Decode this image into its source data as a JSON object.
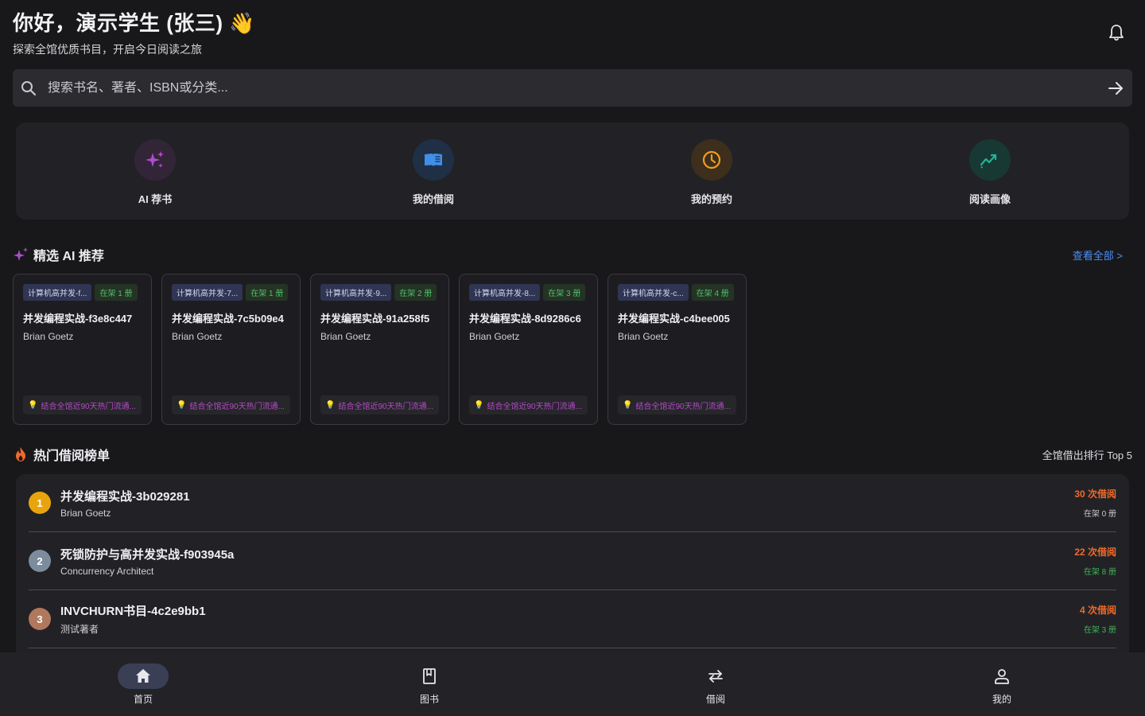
{
  "header": {
    "greeting": "你好，演示学生 (张三) 👋",
    "subtitle": "探索全馆优质书目，开启今日阅读之旅"
  },
  "search": {
    "placeholder": "搜索书名、著者、ISBN或分类..."
  },
  "quick_actions": [
    {
      "label": "AI 荐书",
      "icon": "sparkle-icon",
      "color": "#b04bd0",
      "bg": "#332538"
    },
    {
      "label": "我的借阅",
      "icon": "book-open-icon",
      "color": "#3f8ee8",
      "bg": "#1f2f45"
    },
    {
      "label": "我的预约",
      "icon": "clock-icon",
      "color": "#f29b1f",
      "bg": "#3d2f1c"
    },
    {
      "label": "阅读画像",
      "icon": "trend-chart-icon",
      "color": "#1fb596",
      "bg": "#183833"
    }
  ],
  "recommend": {
    "title": "精选 AI 推荐",
    "view_all": "查看全部 >",
    "books": [
      {
        "category": "计算机高并发-f...",
        "stock": "在架 1 册",
        "title": "并发编程实战-f3e8c447",
        "author": "Brian Goetz",
        "reason": "结合全馆近90天热门流通..."
      },
      {
        "category": "计算机高并发-7...",
        "stock": "在架 1 册",
        "title": "并发编程实战-7c5b09e4",
        "author": "Brian Goetz",
        "reason": "结合全馆近90天热门流通..."
      },
      {
        "category": "计算机高并发-9...",
        "stock": "在架 2 册",
        "title": "并发编程实战-91a258f5",
        "author": "Brian Goetz",
        "reason": "结合全馆近90天热门流通..."
      },
      {
        "category": "计算机高并发-8...",
        "stock": "在架 3 册",
        "title": "并发编程实战-8d9286c6",
        "author": "Brian Goetz",
        "reason": "结合全馆近90天热门流通..."
      },
      {
        "category": "计算机高并发-c...",
        "stock": "在架 4 册",
        "title": "并发编程实战-c4bee005",
        "author": "Brian Goetz",
        "reason": "结合全馆近90天热门流通..."
      }
    ]
  },
  "hot": {
    "title": "热门借阅榜单",
    "note": "全馆借出排行 Top 5",
    "items": [
      {
        "rank": "1",
        "title": "并发编程实战-3b029281",
        "author": "Brian Goetz",
        "count": "30 次借阅",
        "stock": "在架 0 册",
        "badge_color": "#e8a40c",
        "stock_color": "#c8c8ce"
      },
      {
        "rank": "2",
        "title": "死锁防护与高并发实战-f903945a",
        "author": "Concurrency Architect",
        "count": "22 次借阅",
        "stock": "在架 8 册",
        "badge_color": "#7c8c9c",
        "stock_color": "#3fb05a"
      },
      {
        "rank": "3",
        "title": "INVCHURN书目-4c2e9bb1",
        "author": "测试著者",
        "count": "4 次借阅",
        "stock": "在架 3 册",
        "badge_color": "#b0785c",
        "stock_color": "#3fb05a"
      }
    ]
  },
  "bottom_nav": [
    {
      "label": "首页",
      "icon": "home-icon",
      "active": true
    },
    {
      "label": "图书",
      "icon": "bookmark-book-icon",
      "active": false
    },
    {
      "label": "借阅",
      "icon": "swap-arrows-icon",
      "active": false
    },
    {
      "label": "我的",
      "icon": "person-icon",
      "active": false
    }
  ]
}
